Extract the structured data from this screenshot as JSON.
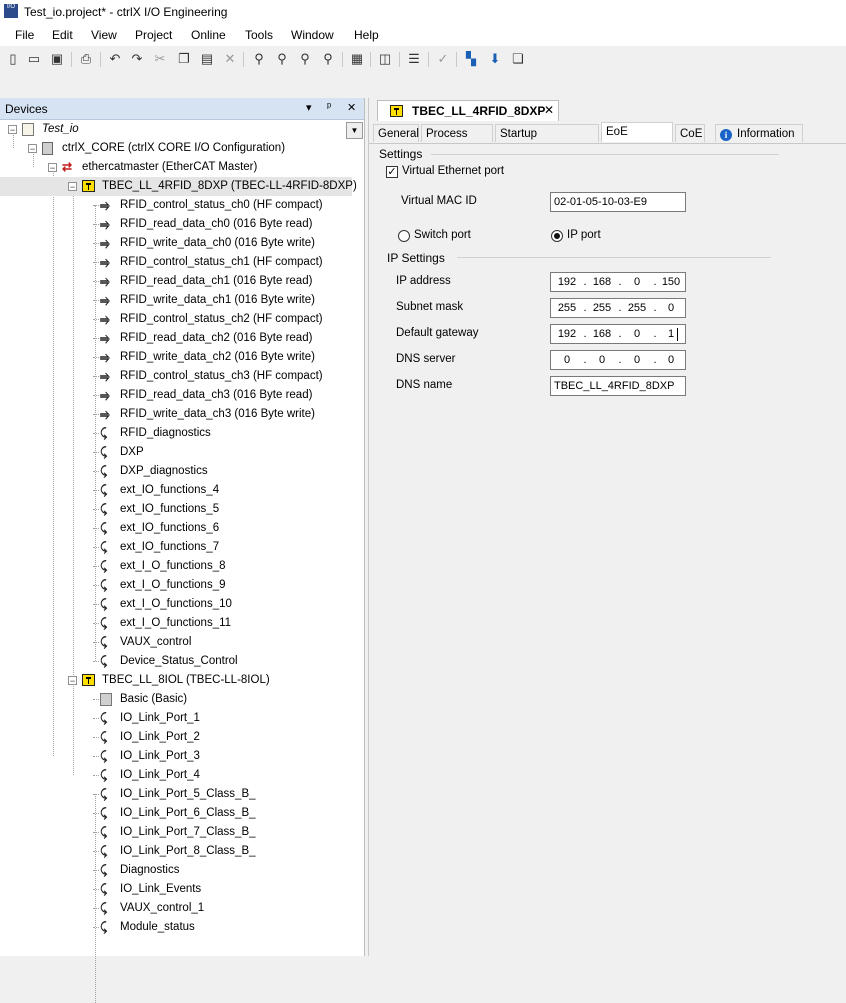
{
  "window": {
    "title": "Test_io.project* - ctrlX I/O Engineering",
    "app_icon_text": "I/O"
  },
  "menu": [
    "File",
    "Edit",
    "View",
    "Project",
    "Online",
    "Tools",
    "Window",
    "Help"
  ],
  "toolbar_icons": [
    "new-icon",
    "open-icon",
    "save-icon",
    "print-icon",
    "undo-icon",
    "redo-icon",
    "cut-icon",
    "copy-icon",
    "paste-icon",
    "delete-icon",
    "find-icon",
    "find-next-icon",
    "find-all-icon",
    "replace-icon",
    "select-all-icon",
    "bookmark-icon",
    "sort-icon",
    "build-icon",
    "login-icon",
    "download-icon",
    "compare-icon"
  ],
  "devices": {
    "title": "Devices",
    "controls": {
      "dropdown": "▾",
      "pin": "ᵖ",
      "close": "✕"
    },
    "tree": [
      {
        "label": "Test_io",
        "icon": "project-icon",
        "italic": true
      },
      {
        "label": "ctrlX_CORE (ctrlX CORE I/O Configuration)",
        "icon": "core-icon"
      },
      {
        "label": "ethercatmaster (EtherCAT Master)",
        "icon": "ethercat-icon"
      },
      {
        "label": "TBEC_LL_4RFID_8DXP (TBEC-LL-4RFID-8DXP)",
        "icon": "module-icon",
        "selected": true
      },
      {
        "label": "RFID_control_status_ch0 (HF compact)",
        "icon": "io-double-icon"
      },
      {
        "label": "RFID_read_data_ch0 (016 Byte read)",
        "icon": "io-double-icon"
      },
      {
        "label": "RFID_write_data_ch0 (016 Byte write)",
        "icon": "io-double-icon"
      },
      {
        "label": "RFID_control_status_ch1 (HF compact)",
        "icon": "io-double-icon"
      },
      {
        "label": "RFID_read_data_ch1 (016 Byte read)",
        "icon": "io-double-icon"
      },
      {
        "label": "RFID_write_data_ch1 (016 Byte write)",
        "icon": "io-double-icon"
      },
      {
        "label": "RFID_control_status_ch2 (HF compact)",
        "icon": "io-double-icon"
      },
      {
        "label": "RFID_read_data_ch2 (016 Byte read)",
        "icon": "io-double-icon"
      },
      {
        "label": "RFID_write_data_ch2 (016 Byte write)",
        "icon": "io-double-icon"
      },
      {
        "label": "RFID_control_status_ch3 (HF compact)",
        "icon": "io-double-icon"
      },
      {
        "label": "RFID_read_data_ch3 (016 Byte read)",
        "icon": "io-double-icon"
      },
      {
        "label": "RFID_write_data_ch3 (016 Byte write)",
        "icon": "io-double-icon"
      },
      {
        "label": "RFID_diagnostics",
        "icon": "io-icon"
      },
      {
        "label": "DXP",
        "icon": "io-icon"
      },
      {
        "label": "DXP_diagnostics",
        "icon": "io-icon"
      },
      {
        "label": "ext_IO_functions_4",
        "icon": "io-icon"
      },
      {
        "label": "ext_IO_functions_5",
        "icon": "io-icon"
      },
      {
        "label": "ext_IO_functions_6",
        "icon": "io-icon"
      },
      {
        "label": "ext_IO_functions_7",
        "icon": "io-icon"
      },
      {
        "label": "ext_I_O_functions_8",
        "icon": "io-icon"
      },
      {
        "label": "ext_I_O_functions_9",
        "icon": "io-icon"
      },
      {
        "label": "ext_I_O_functions_10",
        "icon": "io-icon"
      },
      {
        "label": "ext_I_O_functions_11",
        "icon": "io-icon"
      },
      {
        "label": "VAUX_control",
        "icon": "io-icon"
      },
      {
        "label": "Device_Status_Control",
        "icon": "io-icon"
      },
      {
        "label": "TBEC_LL_8IOL (TBEC-LL-8IOL)",
        "icon": "module-icon"
      },
      {
        "label": "Basic (Basic)",
        "icon": "basic-icon"
      },
      {
        "label": "IO_Link_Port_1",
        "icon": "io-icon"
      },
      {
        "label": "IO_Link_Port_2",
        "icon": "io-icon"
      },
      {
        "label": "IO_Link_Port_3",
        "icon": "io-icon"
      },
      {
        "label": "IO_Link_Port_4",
        "icon": "io-icon"
      },
      {
        "label": "IO_Link_Port_5_Class_B_",
        "icon": "io-icon"
      },
      {
        "label": "IO_Link_Port_6_Class_B_",
        "icon": "io-icon"
      },
      {
        "label": "IO_Link_Port_7_Class_B_",
        "icon": "io-icon"
      },
      {
        "label": "IO_Link_Port_8_Class_B_",
        "icon": "io-icon"
      },
      {
        "label": "Diagnostics",
        "icon": "io-icon"
      },
      {
        "label": "IO_Link_Events",
        "icon": "io-icon"
      },
      {
        "label": "VAUX_control_1",
        "icon": "io-icon"
      },
      {
        "label": "Module_status",
        "icon": "io-icon"
      }
    ]
  },
  "editor": {
    "doc_tab": {
      "label": "TBEC_LL_4RFID_8DXP",
      "close": "✕"
    },
    "tabs": [
      "General",
      "Process Data",
      "Startup Parameters",
      "EoE Settings",
      "CoE",
      "Information"
    ],
    "active_tab": "EoE Settings",
    "settings": {
      "heading": "Settings",
      "virtual_ethernet_label": "Virtual Ethernet port",
      "virtual_ethernet_checked": true,
      "mac_label": "Virtual MAC ID",
      "mac_value": "02-01-05-10-03-E9",
      "switch_port_label": "Switch port",
      "ip_port_label": "IP port",
      "selected_port": "IP port"
    },
    "ip_settings": {
      "heading": "IP Settings",
      "ip_label": "IP address",
      "ip": [
        "192",
        "168",
        "0",
        "150"
      ],
      "subnet_label": "Subnet mask",
      "subnet": [
        "255",
        "255",
        "255",
        "0"
      ],
      "gateway_label": "Default gateway",
      "gateway": [
        "192",
        "168",
        "0",
        "1"
      ],
      "dns_label": "DNS server",
      "dns": [
        "0",
        "0",
        "0",
        "0"
      ],
      "dns_name_label": "DNS name",
      "dns_name": "TBEC_LL_4RFID_8DXP"
    }
  }
}
